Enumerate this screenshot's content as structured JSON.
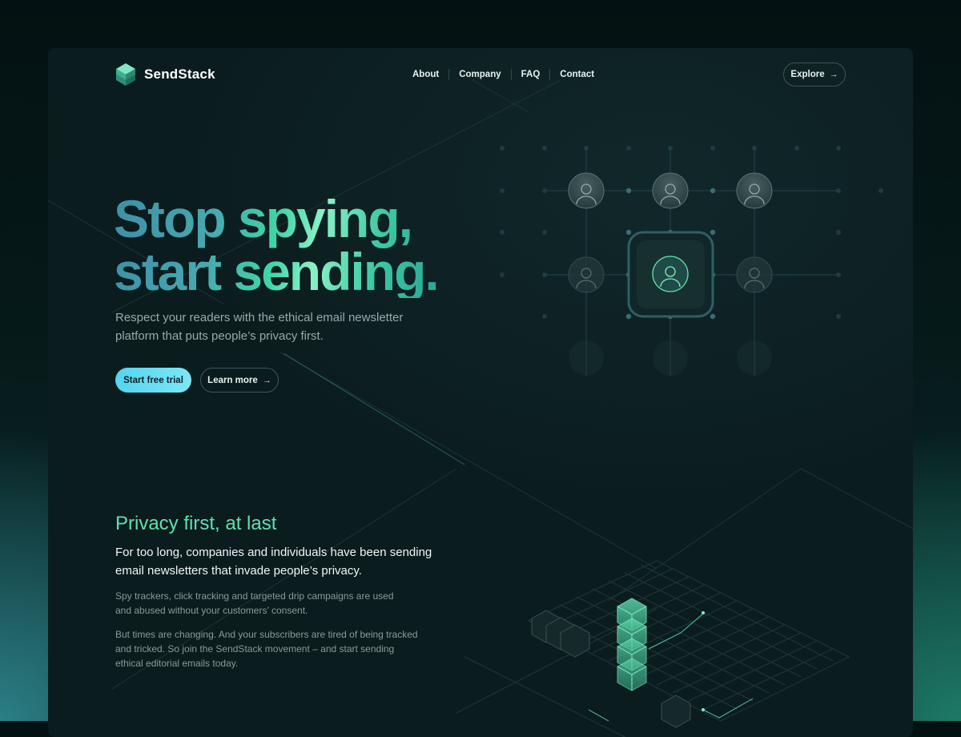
{
  "brand": {
    "name": "SendStack",
    "logo_icon": "stacked-layers-logo-icon"
  },
  "nav": {
    "items": [
      {
        "label": "About"
      },
      {
        "label": "Company"
      },
      {
        "label": "FAQ"
      },
      {
        "label": "Contact"
      }
    ],
    "explore_label": "Explore",
    "explore_icon": "arrow-right-icon"
  },
  "hero": {
    "title_line1": "Stop spying,",
    "title_line2": "start sending.",
    "subtitle": "Respect your readers with the ethical email newsletter platform that puts people’s privacy first.",
    "cta_primary": "Start free trial",
    "cta_secondary": "Learn more",
    "cta_secondary_icon": "arrow-right-icon"
  },
  "privacy": {
    "title": "Privacy first, at last",
    "lead": "For too long, companies and individuals have been sending email newsletters that invade people’s privacy.",
    "paragraph1": "Spy trackers, click tracking and targeted drip campaigns are used and abused without your customers’ consent.",
    "paragraph2": "But times are changing. And your subscribers are tired of being tracked and tricked. So join the SendStack movement – and start sending ethical editorial emails today."
  },
  "colors": {
    "accent_green": "#5fe0b0",
    "accent_cyan": "#6fdff3",
    "frame_bg": "#0b1c1e"
  }
}
